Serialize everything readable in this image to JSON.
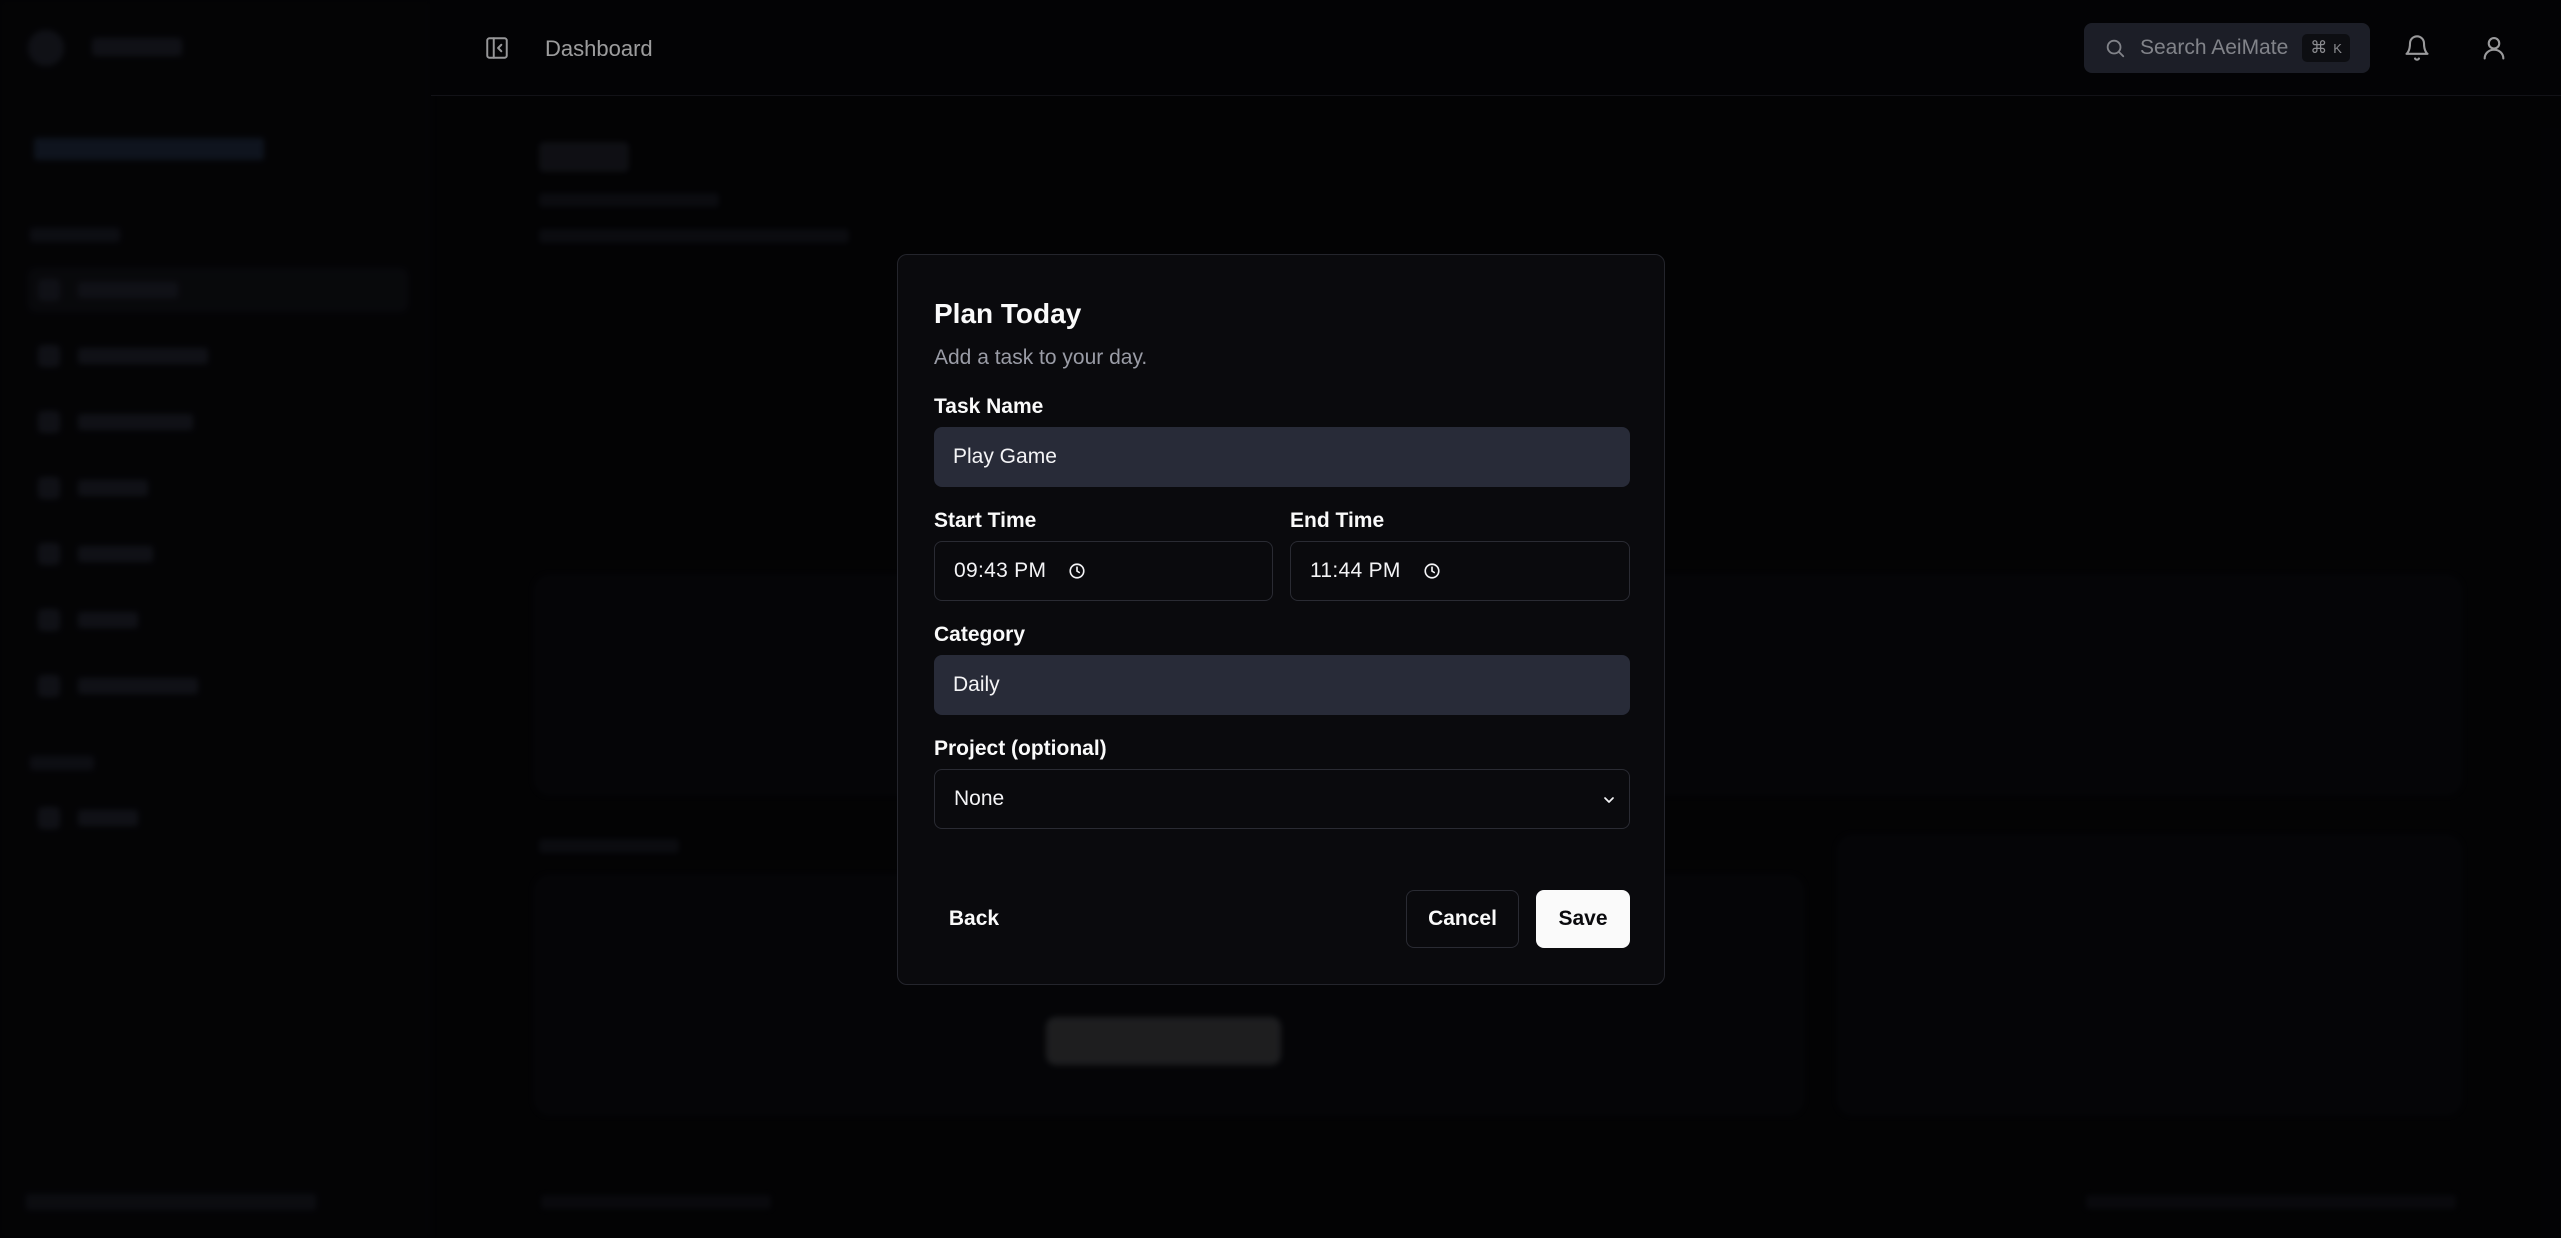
{
  "header": {
    "breadcrumb": "Dashboard",
    "search": {
      "placeholder": "Search AeiMate",
      "shortcut_symbol": "⌘",
      "shortcut_key": "K"
    }
  },
  "dialog": {
    "title": "Plan Today",
    "subtitle": "Add a task to your day.",
    "task_name": {
      "label": "Task Name",
      "value": "Play Game"
    },
    "start_time": {
      "label": "Start Time",
      "value": "09:43  PM"
    },
    "end_time": {
      "label": "End Time",
      "value": "11:44  PM"
    },
    "category": {
      "label": "Category",
      "value": "Daily"
    },
    "project": {
      "label": "Project (optional)",
      "value": "None"
    },
    "buttons": {
      "back": "Back",
      "cancel": "Cancel",
      "save": "Save"
    }
  },
  "icons": {
    "sidebar_toggle": "panel-left-close-icon",
    "search": "search-icon",
    "bell": "bell-icon",
    "user": "user-icon",
    "clock": "clock-icon",
    "chevron": "chevron-down-icon"
  },
  "colors": {
    "background": "#050507",
    "dialog": "#0a0a0d",
    "input_filled": "#282b38",
    "primary_button": "#fafafa"
  }
}
